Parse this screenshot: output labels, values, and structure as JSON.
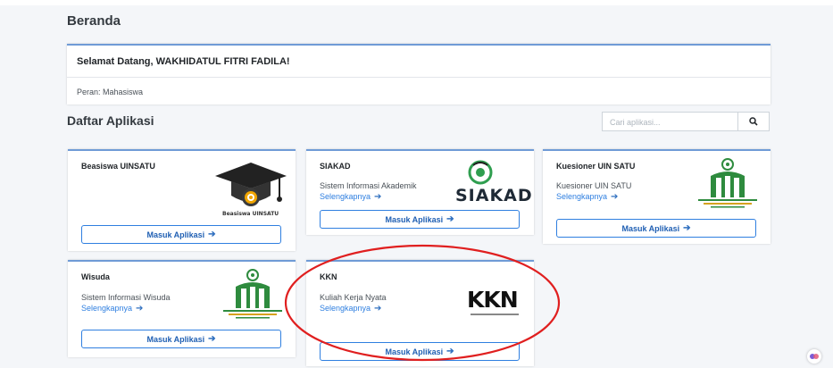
{
  "page": {
    "title": "Beranda"
  },
  "welcome": {
    "greeting": "Selamat Datang, WAKHIDATUL FITRI FADILA!",
    "role": "Peran: Mahasiswa"
  },
  "apps_section": {
    "title": "Daftar Aplikasi",
    "search_placeholder": "Cari aplikasi...",
    "search_icon": "search-icon"
  },
  "apps": [
    {
      "name": "Beasiswa UINSATU",
      "description": "",
      "more": "",
      "button": "Masuk Aplikasi",
      "logo_text": "Beasiswa UINSATU",
      "icon": "graduation-cap-icon"
    },
    {
      "name": "SIAKAD",
      "description": "Sistem Informasi Akademik",
      "more": "Selengkapnya",
      "button": "Masuk Aplikasi",
      "logo_text": "SIAKAD",
      "icon": "siakad-logo-icon"
    },
    {
      "name": "Kuesioner UIN SATU",
      "description": "Kuesioner UIN SATU",
      "more": "Selengkapnya",
      "button": "Masuk Aplikasi",
      "icon": "uin-satu-logo-icon"
    },
    {
      "name": "Wisuda",
      "description": "Sistem Informasi Wisuda",
      "more": "Selengkapnya",
      "button": "Masuk Aplikasi",
      "icon": "uin-satu-logo-icon"
    },
    {
      "name": "KKN",
      "description": "Kuliah Kerja Nyata",
      "more": "Selengkapnya",
      "button": "Masuk Aplikasi",
      "logo_text": "KKN",
      "icon": "kkn-logo-icon"
    }
  ],
  "colors": {
    "accent": "#2f7fe0",
    "card_top": "#6f9bd6",
    "annotation": "#e01f1f",
    "background": "#f4f6f9"
  }
}
